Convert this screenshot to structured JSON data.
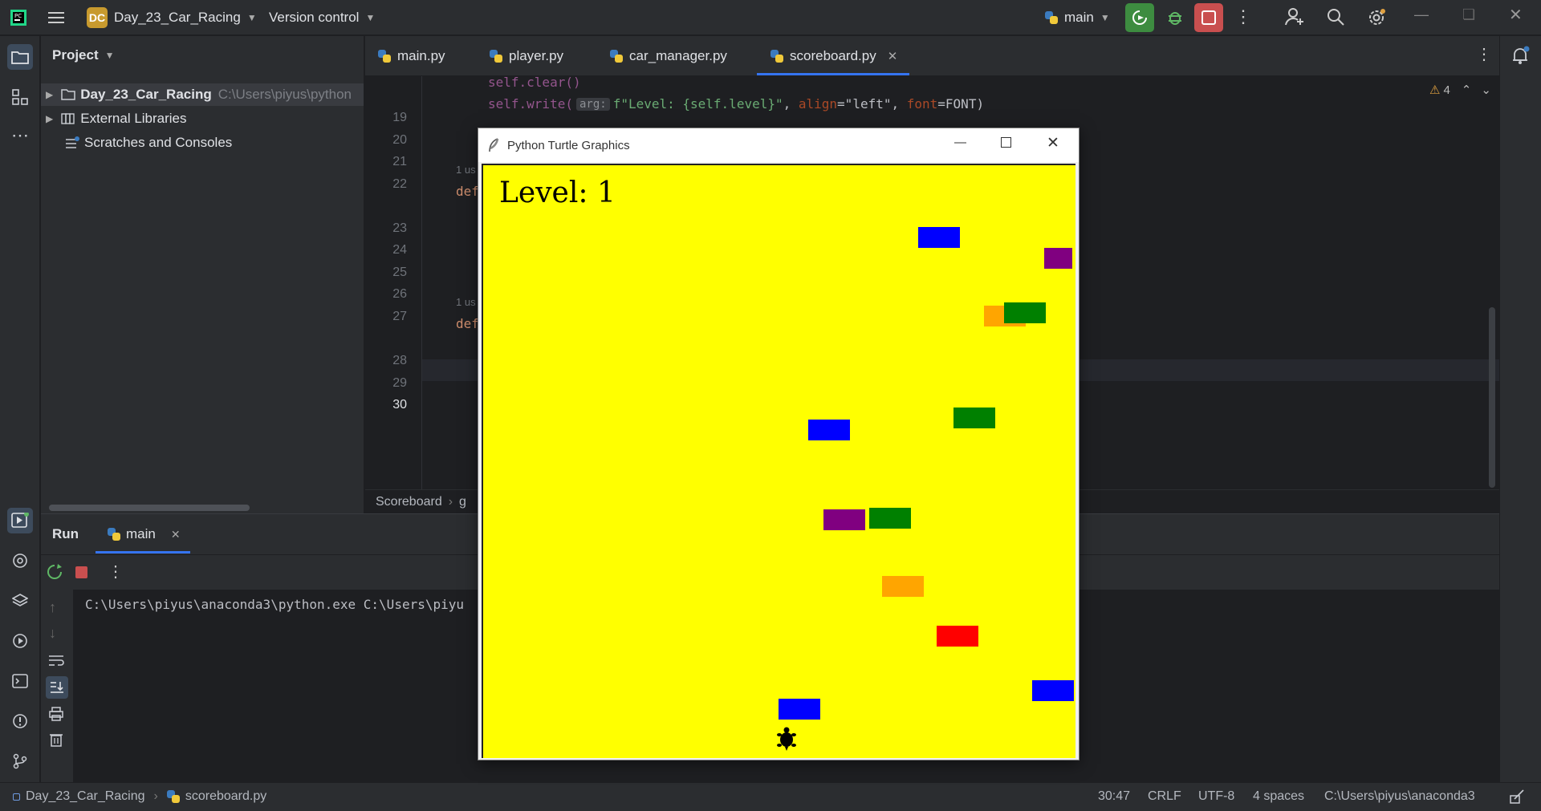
{
  "titlebar": {
    "project_badge": "DC",
    "project_name": "Day_23_Car_Racing",
    "vcs": "Version control",
    "branch": "main"
  },
  "project_panel": {
    "title": "Project",
    "root": "Day_23_Car_Racing",
    "root_path": "C:\\Users\\piyus\\python",
    "external_libraries": "External Libraries",
    "scratches": "Scratches and Consoles"
  },
  "editor": {
    "tabs": [
      {
        "label": "main.py"
      },
      {
        "label": "player.py"
      },
      {
        "label": "car_manager.py"
      },
      {
        "label": "scoreboard.py"
      }
    ],
    "line_numbers": [
      "19",
      "20",
      "21",
      "22",
      "23",
      "24",
      "25",
      "26",
      "27",
      "28",
      "29",
      "30"
    ],
    "code_line_19": "self.clear()",
    "code_line_20_a": "self.write(",
    "code_line_20_hint": "arg:",
    "code_line_20_b": "f\"Level: {self.level}\"",
    "code_line_20_c": ", ",
    "code_line_20_align": "align",
    "code_line_20_d": "=\"left\", ",
    "code_line_20_font": "font",
    "code_line_20_e": "=FONT)",
    "usage_1": "1 us",
    "usage_2": "1 us",
    "def_1": "def",
    "def_2": "def",
    "warning_count": "4",
    "breadcrumb_class": "Scoreboard",
    "breadcrumb_method": "g"
  },
  "run_panel": {
    "tab_run": "Run",
    "tab_main": "main",
    "console_line": "C:\\Users\\piyus\\anaconda3\\python.exe C:\\Users\\piyu"
  },
  "turtle_window": {
    "title": "Python Turtle Graphics",
    "level_text": "Level: 1",
    "cars": [
      {
        "color": "#0000ff"
      },
      {
        "color": "#800080"
      },
      {
        "color": "#ffa500"
      },
      {
        "color": "#008000"
      },
      {
        "color": "#0000ff"
      },
      {
        "color": "#008000"
      },
      {
        "color": "#800080"
      },
      {
        "color": "#008000"
      },
      {
        "color": "#ffa500"
      },
      {
        "color": "#ff0000"
      },
      {
        "color": "#0000ff"
      },
      {
        "color": "#0000ff"
      }
    ]
  },
  "statusbar": {
    "crumb_project": "Day_23_Car_Racing",
    "crumb_file": "scoreboard.py",
    "position": "30:47",
    "line_sep": "CRLF",
    "encoding": "UTF-8",
    "indent": "4 spaces",
    "interpreter": "C:\\Users\\piyus\\anaconda3"
  },
  "colors": {
    "run_green": "#3d8c40",
    "stop_red": "#c94f4f",
    "canvas_yellow": "#ffff00"
  }
}
